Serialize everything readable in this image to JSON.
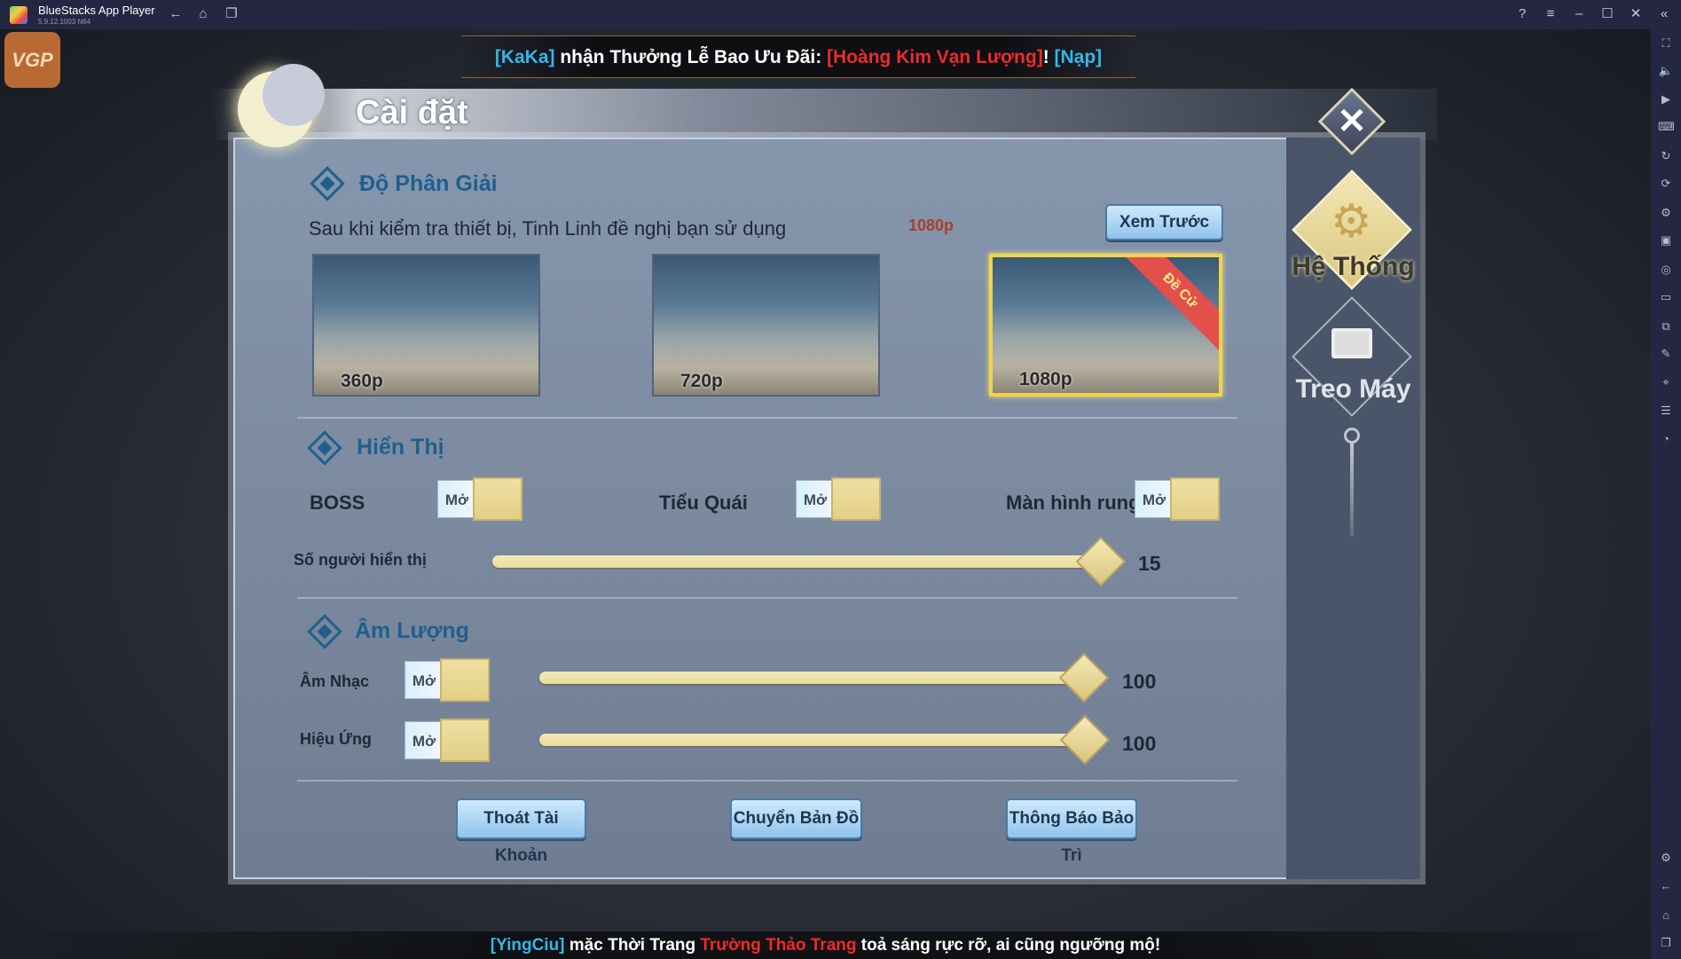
{
  "titlebar": {
    "app_name": "BlueStacks App Player",
    "version": "5.9.12.1003 N64"
  },
  "banner": {
    "player": "[KaKa]",
    "text": " nhận Thưởng Lễ Bao Ưu Đãi: ",
    "item": "[Hoàng Kim Vạn Lượng]",
    "excl": "! ",
    "action": "[Nạp]"
  },
  "logo": "VGP",
  "settings": {
    "title": "Cài đặt",
    "resolution": {
      "heading": "Độ Phân Giải",
      "recommend_text": "Sau khi kiểm tra thiết bị, Tinh Linh đề nghị bạn sử dụng",
      "recommended": "1080p",
      "preview_button": "Xem Trước",
      "options": [
        {
          "label": "360p",
          "selected": false
        },
        {
          "label": "720p",
          "selected": false
        },
        {
          "label": "1080p",
          "selected": true,
          "badge": "Đề Cử"
        }
      ]
    },
    "display": {
      "heading": "Hiển Thị",
      "toggles": [
        {
          "label": "BOSS",
          "state": "Mở"
        },
        {
          "label": "Tiểu Quái",
          "state": "Mở"
        },
        {
          "label": "Màn hình rung",
          "state": "Mở"
        }
      ],
      "players_shown": {
        "label": "Số người hiển thị",
        "value": "15"
      }
    },
    "volume": {
      "heading": "Âm Lượng",
      "rows": [
        {
          "label": "Âm Nhạc",
          "state": "Mở",
          "value": "100"
        },
        {
          "label": "Hiệu Ứng",
          "state": "Mở",
          "value": "100"
        }
      ]
    },
    "buttons": [
      "Thoát Tài Khoản",
      "Chuyển Bản Đồ",
      "Thông Báo Bảo Trì"
    ],
    "tabs": [
      {
        "label": "Hệ Thống",
        "icon": "gear-icon",
        "active": true
      },
      {
        "label": "Treo Máy",
        "icon": "monitor-icon",
        "active": false
      }
    ]
  },
  "bottom_message": {
    "player": "[YingCiu]",
    "text1": " mặc Thời Trang ",
    "item": "Trường Thảo Trang",
    "text2": " toả sáng rực rỡ, ai cũng ngưỡng mộ!"
  },
  "colors": {
    "accent_blue": "#1f5f8d",
    "gold": "#e9dc98",
    "recommend": "#a8402a"
  }
}
